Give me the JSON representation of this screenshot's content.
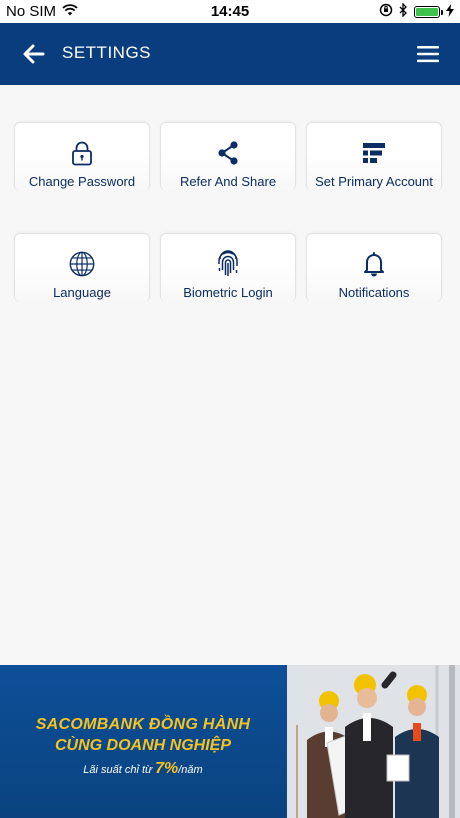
{
  "status_bar": {
    "carrier": "No SIM",
    "time": "14:45"
  },
  "header": {
    "title": "SETTINGS",
    "back_icon": "arrow-left-icon",
    "menu_icon": "hamburger-menu-icon"
  },
  "settings": {
    "items": [
      {
        "label": "Change Password",
        "icon": "lock-icon"
      },
      {
        "label": "Refer And Share",
        "icon": "share-icon"
      },
      {
        "label": "Set Primary Account",
        "icon": "primary-account-icon"
      },
      {
        "label": "Language",
        "icon": "globe-icon"
      },
      {
        "label": "Biometric Login",
        "icon": "fingerprint-icon"
      },
      {
        "label": "Notifications",
        "icon": "bell-icon"
      }
    ]
  },
  "banner": {
    "line1": "SACOMBANK ĐỒNG HÀNH",
    "line2": "CÙNG DOANH NGHIỆP",
    "line3_prefix": "Lãi suất chỉ từ",
    "rate": "7%",
    "line3_suffix": "/năm"
  },
  "colors": {
    "header_bg": "#0a3d7e",
    "label_text": "#0b2d62",
    "banner_yellow": "#f7c21d"
  }
}
